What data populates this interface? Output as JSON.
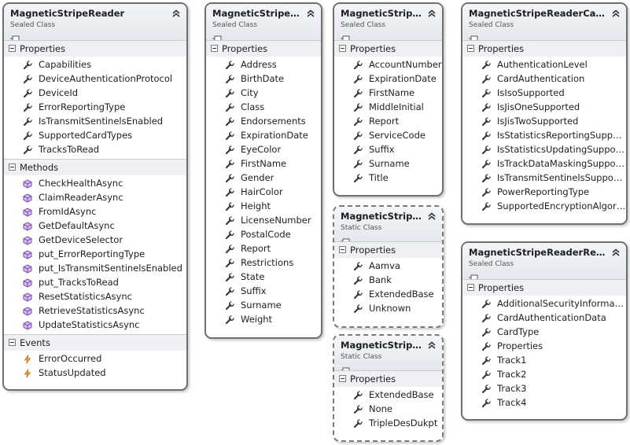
{
  "icons": {
    "property": "wrench-icon",
    "method": "cube-icon",
    "event": "lightning-icon",
    "enum_value": "wrench-icon"
  },
  "colors": {
    "border": "#6f6f6f",
    "header_bg": "#e4e8ee",
    "section_bg": "#eef0f3",
    "method_icon": "#8e5bb8",
    "event_icon": "#e08a1c"
  },
  "classes": [
    {
      "id": "msr",
      "title": "MagneticStripeReader",
      "stereotype": "Sealed Class",
      "sections": [
        {
          "label": "Properties",
          "kind": "property",
          "items": [
            "Capabilities",
            "DeviceAuthenticationProtocol",
            "DeviceId",
            "ErrorReportingType",
            "IsTransmitSentinelsEnabled",
            "SupportedCardTypes",
            "TracksToRead"
          ]
        },
        {
          "label": "Methods",
          "kind": "method",
          "items": [
            "CheckHealthAsync",
            "ClaimReaderAsync",
            "FromIdAsync",
            "GetDefaultAsync",
            "GetDeviceSelector",
            "put_ErrorReportingType",
            "put_IsTransmitSentinelsEnabled",
            "put_TracksToRead",
            "ResetStatisticsAsync",
            "RetrieveStatisticsAsync",
            "UpdateStatisticsAsync"
          ]
        },
        {
          "label": "Events",
          "kind": "event",
          "items": [
            "ErrorOccurred",
            "StatusUpdated"
          ]
        }
      ]
    },
    {
      "id": "aamva",
      "title": "MagneticStripe...",
      "stereotype": "Sealed Class",
      "sections": [
        {
          "label": "Properties",
          "kind": "property",
          "items": [
            "Address",
            "BirthDate",
            "City",
            "Class",
            "Endorsements",
            "ExpirationDate",
            "EyeColor",
            "FirstName",
            "Gender",
            "HairColor",
            "Height",
            "LicenseNumber",
            "PostalCode",
            "Report",
            "Restrictions",
            "State",
            "Suffix",
            "Surname",
            "Weight"
          ]
        }
      ]
    },
    {
      "id": "bank",
      "title": "MagneticStripe...",
      "stereotype": "Sealed Class",
      "sections": [
        {
          "label": "Properties",
          "kind": "property",
          "items": [
            "AccountNumber",
            "ExpirationDate",
            "FirstName",
            "MiddleInitial",
            "Report",
            "ServiceCode",
            "Suffix",
            "Surname",
            "Title"
          ]
        }
      ]
    },
    {
      "id": "cardtypes",
      "title": "MagneticStripe...",
      "stereotype": "Static Class",
      "sections": [
        {
          "label": "Properties",
          "kind": "enum_value",
          "items": [
            "Aamva",
            "Bank",
            "ExtendedBase",
            "Unknown"
          ]
        }
      ]
    },
    {
      "id": "encalg",
      "title": "MagneticStripe...",
      "stereotype": "Static Class",
      "sections": [
        {
          "label": "Properties",
          "kind": "enum_value",
          "items": [
            "ExtendedBase",
            "None",
            "TripleDesDukpt"
          ]
        }
      ]
    },
    {
      "id": "caps",
      "title": "MagneticStripeReaderCapab...",
      "stereotype": "Sealed Class",
      "sections": [
        {
          "label": "Properties",
          "kind": "property",
          "items": [
            "AuthenticationLevel",
            "CardAuthentication",
            "IsIsoSupported",
            "IsJisOneSupported",
            "IsJisTwoSupported",
            "IsStatisticsReportingSupport...",
            "IsStatisticsUpdatingSupported",
            "IsTrackDataMaskingSupported",
            "IsTransmitSentinelsSupported",
            "PowerReportingType",
            "SupportedEncryptionAlgorit..."
          ]
        }
      ]
    },
    {
      "id": "report",
      "title": "MagneticStripeReaderReport",
      "stereotype": "Sealed Class",
      "sections": [
        {
          "label": "Properties",
          "kind": "property",
          "items": [
            "AdditionalSecurityInformation",
            "CardAuthenticationData",
            "CardType",
            "Properties",
            "Track1",
            "Track2",
            "Track3",
            "Track4"
          ]
        }
      ]
    }
  ]
}
